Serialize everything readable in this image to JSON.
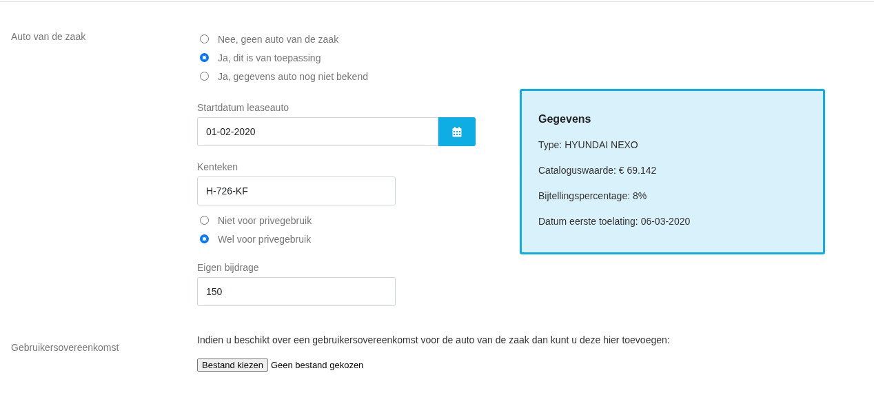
{
  "company_car": {
    "label": "Auto van de zaak",
    "options": [
      {
        "label": "Nee, geen auto van de zaak",
        "selected": false
      },
      {
        "label": "Ja, dit is van toepassing",
        "selected": true
      },
      {
        "label": "Ja, gegevens auto nog niet bekend",
        "selected": false
      }
    ],
    "start_date": {
      "label": "Startdatum leaseauto",
      "value": "01-02-2020"
    },
    "plate": {
      "label": "Kenteken",
      "value": "H-726-KF"
    },
    "usage_options": [
      {
        "label": "Niet voor privegebruik",
        "selected": false
      },
      {
        "label": "Wel voor privegebruik",
        "selected": true
      }
    ],
    "contribution": {
      "label": "Eigen bijdrage",
      "value": "150"
    },
    "details": {
      "title": "Gegevens",
      "lines": [
        "Type: HYUNDAI NEXO",
        "Cataloguswaarde: € 69.142",
        "Bijtellingspercentage: 8%",
        "Datum eerste toelating: 06-03-2020"
      ]
    }
  },
  "agreement": {
    "label": "Gebruikersovereenkomst",
    "text": "Indien u beschikt over een gebruikersovereenkomst voor de auto van de zaak dan kunt u deze hier toevoegen:",
    "file_button": "Bestand kiezen",
    "file_status": "Geen bestand gekozen"
  }
}
